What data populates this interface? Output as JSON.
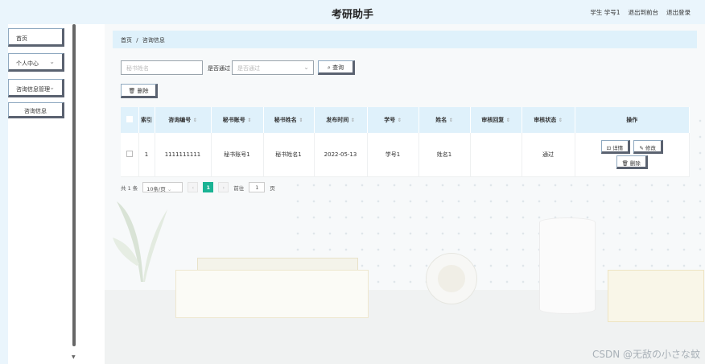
{
  "header": {
    "title": "考研助手",
    "user_label": "学生 学号1",
    "front_link": "退出到前台",
    "logout_link": "退出登录"
  },
  "sidebar": {
    "items": [
      {
        "label": "首页"
      },
      {
        "label": "个人中心",
        "chevron": "chevron-down-icon"
      },
      {
        "label": "咨询信息管理",
        "chevron": "chevron-down-icon"
      },
      {
        "label": "咨询信息"
      }
    ]
  },
  "breadcrumb": {
    "home": "首页",
    "separator": "/",
    "current": "咨询信息"
  },
  "search": {
    "name_placeholder": "秘书姓名",
    "passed_label": "是否通过",
    "passed_placeholder": "是否通过",
    "query_button": "查询",
    "delete_button": "删除"
  },
  "table": {
    "headers": [
      "索引",
      "咨询编号",
      "秘书账号",
      "秘书姓名",
      "发布时间",
      "学号",
      "姓名",
      "审核回复",
      "审核状态",
      "操作"
    ],
    "rows": [
      {
        "index": "1",
        "consult_no": "1111111111",
        "secretary_account": "秘书账号1",
        "secretary_name": "秘书姓名1",
        "publish_time": "2022-05-13",
        "student_no": "学号1",
        "name": "姓名1",
        "review_reply": "",
        "review_status": "通过",
        "actions": {
          "detail": "详情",
          "edit": "修改",
          "delete": "删除"
        }
      }
    ]
  },
  "pagination": {
    "total": "共 1 条",
    "page_size": "10条/页",
    "prev": "‹",
    "current_page": "1",
    "next": "›",
    "goto_prefix": "前往",
    "goto_value": "1",
    "goto_suffix": "页"
  },
  "watermark": "CSDN @无敌の小さな蚊",
  "colors": {
    "header_bg": "#eaf5fc",
    "table_header_bg": "#dff1fb",
    "accent": "#1ab394"
  }
}
